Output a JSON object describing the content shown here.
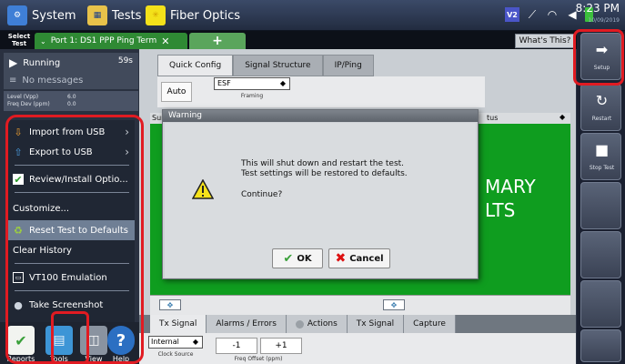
{
  "topbar": {
    "system_label": "System",
    "tests_label": "Tests",
    "fiber_label": "Fiber Optics",
    "time": "8:23 PM",
    "date": "10/09/2019",
    "v_badge": "V2"
  },
  "test_tabs": {
    "select_test": "Select Test",
    "port_tab": "Port 1: DS1 PPP Ping Term",
    "add_tab": "+",
    "whats_this": "What's This?"
  },
  "status": {
    "state": "Running",
    "elapsed": "59s",
    "messages": "No messages",
    "level_label": "Level (Vpp)",
    "level_value": "6.0",
    "freq_label": "Freq Dev (ppm)",
    "freq_value": "0.0"
  },
  "tools_menu": {
    "items": [
      {
        "label": "Import from USB",
        "icon": "usb-import-icon"
      },
      {
        "label": "Export to USB",
        "icon": "usb-export-icon"
      },
      {
        "label": "Review/Install Optio...",
        "icon": "checkbox-icon"
      },
      {
        "label": "Customize...",
        "icon": ""
      },
      {
        "label": "Reset Test to Defaults",
        "icon": "reset-icon"
      },
      {
        "label": "Clear History",
        "icon": ""
      },
      {
        "label": "VT100 Emulation",
        "icon": "terminal-icon"
      },
      {
        "label": "Take Screenshot",
        "icon": "camera-icon"
      }
    ]
  },
  "dock": {
    "items": [
      {
        "label": "Reports"
      },
      {
        "label": "Tools"
      },
      {
        "label": "View"
      },
      {
        "label": "Help"
      }
    ]
  },
  "config_tabs": [
    "Quick Config",
    "Signal Structure",
    "IP/Ping"
  ],
  "config": {
    "auto_label": "Auto",
    "framing_value": "ESF",
    "framing_label": "Framing"
  },
  "results": {
    "left_header": "Sur",
    "right_header": "tus",
    "summary_line1": "MARY",
    "summary_line2": "LTS"
  },
  "bottom_tabs": [
    "Tx Signal",
    "Alarms / Errors",
    "Actions",
    "Tx Signal",
    "Capture"
  ],
  "tx": {
    "clock_value": "Internal",
    "clock_label": "Clock Source",
    "minus": "-1",
    "plus": "+1",
    "freq_label": "Freq Offset (ppm)"
  },
  "dialog": {
    "title": "Warning",
    "line1": "This will shut down and restart the test.",
    "line2": "Test settings will be restored to defaults.",
    "line3": "Continue?",
    "ok_label": "OK",
    "cancel_label": "Cancel"
  },
  "sidebar": {
    "setup_label": "Setup",
    "restart_label": "Restart",
    "stop_label": "Stop Test"
  },
  "colors": {
    "accent_green": "#0f9d1f",
    "callout_red": "#e11b22"
  }
}
